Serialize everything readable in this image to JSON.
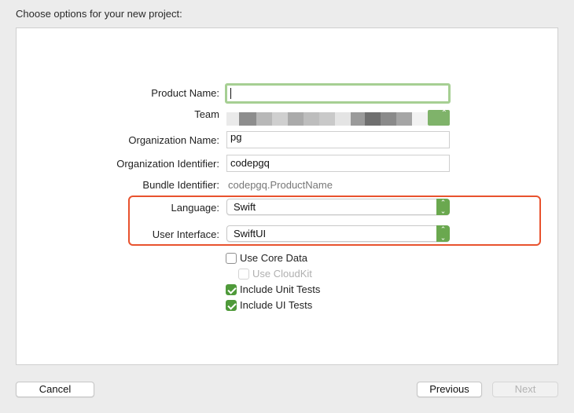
{
  "header": {
    "title": "Choose options for your new project:"
  },
  "form": {
    "product_name": {
      "label": "Product Name:",
      "value": ""
    },
    "team": {
      "label": "Team"
    },
    "organization_name": {
      "label": "Organization Name:",
      "value": "pg"
    },
    "organization_identifier": {
      "label": "Organization Identifier:",
      "value": "codepgq"
    },
    "bundle_identifier": {
      "label": "Bundle Identifier:",
      "value": "codepgq.ProductName"
    },
    "language": {
      "label": "Language:",
      "value": "Swift"
    },
    "user_interface": {
      "label": "User Interface:",
      "value": "SwiftUI"
    }
  },
  "options": {
    "use_core_data": {
      "label": "Use Core Data",
      "checked": false
    },
    "use_cloudkit": {
      "label": "Use CloudKit",
      "checked": false,
      "disabled": true
    },
    "include_unit_tests": {
      "label": "Include Unit Tests",
      "checked": true
    },
    "include_ui_tests": {
      "label": "Include UI Tests",
      "checked": true
    }
  },
  "footer": {
    "cancel_label": "Cancel",
    "previous_label": "Previous",
    "next_label": "Next"
  },
  "colors": {
    "focus_ring": "#a6cf93",
    "accent": "#4f9a3a",
    "highlight_box": "#e8522e"
  }
}
